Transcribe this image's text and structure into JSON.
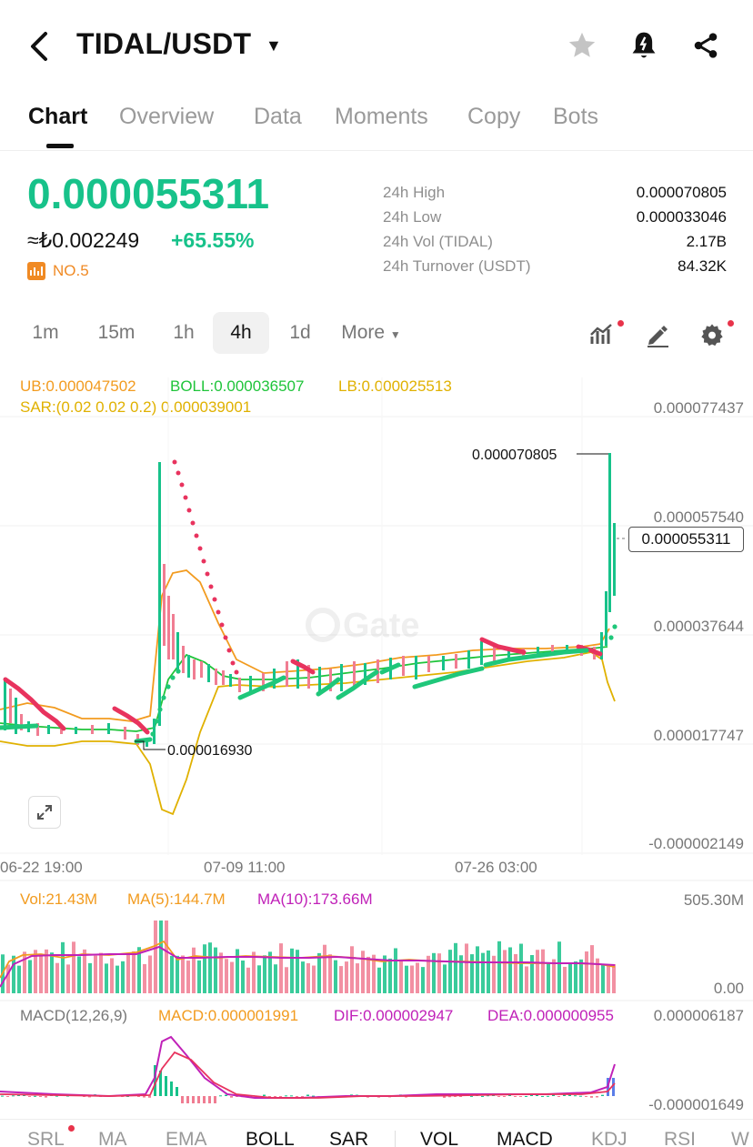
{
  "header": {
    "pair": "TIDAL/USDT"
  },
  "tabs": [
    "Chart",
    "Overview",
    "Data",
    "Moments",
    "Copy",
    "Bots"
  ],
  "price": {
    "last": "0.000055311",
    "fiat": "≈₺0.002249",
    "change": "+65.55%",
    "rank": "NO.5"
  },
  "stats": [
    {
      "label": "24h High",
      "value": "0.000070805"
    },
    {
      "label": "24h Low",
      "value": "0.000033046"
    },
    {
      "label": "24h Vol (TIDAL)",
      "value": "2.17B"
    },
    {
      "label": "24h Turnover (USDT)",
      "value": "84.32K"
    }
  ],
  "intervals": [
    "1m",
    "15m",
    "1h",
    "4h",
    "1d",
    "More"
  ],
  "indicators": {
    "ub": "UB:0.000047502",
    "boll": "BOLL:0.000036507",
    "lb": "LB:0.000025513",
    "sar": "SAR:(0.02 0.02 0.2) 0.000039001",
    "vol": "Vol:21.43M",
    "ma5": "MA(5):144.7M",
    "ma10": "MA(10):173.66M",
    "macd_title": "MACD(12,26,9)",
    "macd": "MACD:0.000001991",
    "dif": "DIF:0.000002947",
    "dea": "DEA:0.000000955"
  },
  "chart": {
    "price_axis": [
      "0.000077437",
      "0.000057540",
      "0.000037644",
      "0.000017747",
      "-0.000002149"
    ],
    "current_price": "0.000055311",
    "high_marker": "0.000070805",
    "low_marker": "0.000016930",
    "dates": [
      "06-22 19:00",
      "07-09 11:00",
      "07-26 03:00"
    ],
    "vol_axis": [
      "505.30M",
      "0.00"
    ],
    "macd_axis": [
      "0.000006187",
      "-0.000001649"
    ],
    "watermark": "Gate"
  },
  "colors": {
    "up": "#17c28a",
    "down": "#f07d92",
    "ub": "#f29b1f",
    "boll": "#1fc43a",
    "lb": "#e0b100",
    "sar": "#e8335e",
    "ma10": "#c021b8"
  },
  "bottom_tabs": [
    "SRL",
    "MA",
    "EMA",
    "BOLL",
    "SAR",
    "VOL",
    "MACD",
    "KDJ",
    "RSI",
    "W"
  ],
  "bottom_active": [
    "BOLL",
    "SAR",
    "VOL",
    "MACD"
  ]
}
